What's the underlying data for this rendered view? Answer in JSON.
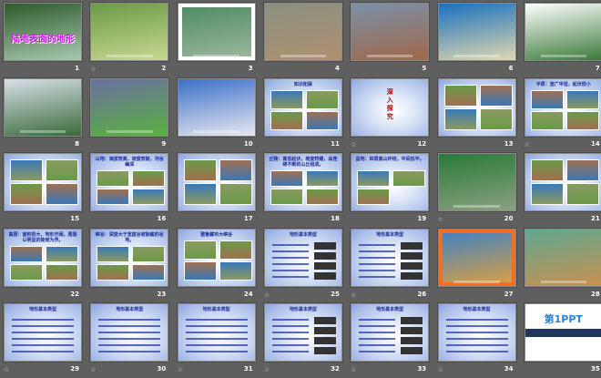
{
  "view": "slide-sorter",
  "slides": [
    {
      "n": "1",
      "anim": false,
      "kind": "title",
      "title": "陆地表面的地形",
      "colors": [
        "#2e5a2a",
        "#a8c8b0"
      ]
    },
    {
      "n": "2",
      "anim": true,
      "kind": "photo",
      "colors": [
        "#6a9a48",
        "#c8d890"
      ]
    },
    {
      "n": "3",
      "anim": false,
      "kind": "photo",
      "colors": [
        "#4a8a60",
        "#a0b8a0"
      ],
      "frame": "#ffffff"
    },
    {
      "n": "4",
      "anim": false,
      "kind": "photo",
      "colors": [
        "#8a9080",
        "#b09070"
      ]
    },
    {
      "n": "5",
      "anim": false,
      "kind": "photo",
      "colors": [
        "#7a90a8",
        "#a06848"
      ]
    },
    {
      "n": "6",
      "anim": false,
      "kind": "photo",
      "colors": [
        "#1a70c0",
        "#e0d8b0"
      ]
    },
    {
      "n": "7",
      "anim": false,
      "kind": "photo",
      "colors": [
        "#ffffff",
        "#3a7a3a"
      ]
    },
    {
      "n": "8",
      "anim": false,
      "kind": "photo",
      "colors": [
        "#d8e0e8",
        "#3a6a3a"
      ]
    },
    {
      "n": "9",
      "anim": false,
      "kind": "photo",
      "colors": [
        "#6a70a0",
        "#5ab040"
      ]
    },
    {
      "n": "10",
      "anim": false,
      "kind": "photo",
      "colors": [
        "#3a70c8",
        "#e8e8f0"
      ]
    },
    {
      "n": "11",
      "anim": false,
      "kind": "blue",
      "photos": 4,
      "title": "知识拓展"
    },
    {
      "n": "12",
      "anim": true,
      "kind": "blue",
      "photos": 0,
      "title": "深入探究",
      "red": true
    },
    {
      "n": "13",
      "anim": false,
      "kind": "blue",
      "photos": 4
    },
    {
      "n": "14",
      "anim": true,
      "kind": "blue",
      "photos": 4,
      "title": "平原：宽广平坦，起伏很小"
    },
    {
      "n": "15",
      "anim": false,
      "kind": "blue",
      "photos": 4
    },
    {
      "n": "16",
      "anim": false,
      "kind": "blue",
      "photos": 4,
      "title": "山地：海拔较高，坡度较陡，沟谷幽深"
    },
    {
      "n": "17",
      "anim": false,
      "kind": "blue",
      "photos": 4
    },
    {
      "n": "18",
      "anim": false,
      "kind": "blue",
      "photos": 4,
      "title": "丘陵：高低起伏，坡度较缓，由连绵不断的山丘组成。"
    },
    {
      "n": "19",
      "anim": false,
      "kind": "blue",
      "photos": 3,
      "title": "盆地：四周高山环绕，中间低平。"
    },
    {
      "n": "20",
      "anim": true,
      "kind": "photo",
      "colors": [
        "#2a7a3a",
        "#8aa080"
      ]
    },
    {
      "n": "21",
      "anim": false,
      "kind": "blue",
      "photos": 4
    },
    {
      "n": "22",
      "anim": false,
      "kind": "blue",
      "photos": 4,
      "title": "高原：面积很大，地形开阔，周围以明显的陡坡为界。"
    },
    {
      "n": "23",
      "anim": false,
      "kind": "blue",
      "photos": 4,
      "title": "峡谷：深度大于宽度谷坡陡峻的谷地。"
    },
    {
      "n": "24",
      "anim": false,
      "kind": "blue",
      "photos": 4,
      "title": "雅鲁藏布大峡谷"
    },
    {
      "n": "25",
      "anim": true,
      "kind": "quiz",
      "title": "地形基本类型"
    },
    {
      "n": "26",
      "anim": true,
      "kind": "quiz",
      "title": "地形基本类型"
    },
    {
      "n": "27",
      "anim": false,
      "kind": "photo",
      "colors": [
        "#3a80c8",
        "#e0a040"
      ],
      "frame": "#f07020"
    },
    {
      "n": "28",
      "anim": false,
      "kind": "photo",
      "colors": [
        "#60a890",
        "#c89050"
      ]
    },
    {
      "n": "29",
      "anim": true,
      "kind": "text",
      "title": "地形基本类型"
    },
    {
      "n": "30",
      "anim": true,
      "kind": "text",
      "title": "地形基本类型"
    },
    {
      "n": "31",
      "anim": true,
      "kind": "text",
      "title": "地形基本类型"
    },
    {
      "n": "32",
      "anim": true,
      "kind": "quiz",
      "title": "地形基本类型"
    },
    {
      "n": "33",
      "anim": true,
      "kind": "quiz",
      "title": "地形基本类型"
    },
    {
      "n": "34",
      "anim": true,
      "kind": "text",
      "title": "地形基本类型"
    },
    {
      "n": "35",
      "anim": false,
      "kind": "ppt",
      "title": "第1PPT"
    }
  ],
  "anim_icon": "☆",
  "photo_colors": [
    "#6a9a48",
    "#a07050",
    "#3a78b8",
    "#8a9a60"
  ]
}
